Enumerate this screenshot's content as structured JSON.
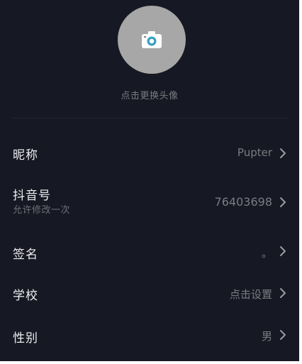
{
  "avatar": {
    "hint": "点击更换头像",
    "icon": "camera-icon",
    "bg_color": "#a7a7a7"
  },
  "rows": [
    {
      "label": "昵称",
      "sub": "",
      "value": "Pupter"
    },
    {
      "label": "抖音号",
      "sub": "允许修改一次",
      "value": "76403698"
    },
    {
      "label": "签名",
      "sub": "",
      "value": "。"
    },
    {
      "label": "学校",
      "sub": "",
      "value": "点击设置"
    },
    {
      "label": "性别",
      "sub": "",
      "value": "男"
    }
  ],
  "colors": {
    "background": "#161823",
    "label": "#eeeef0",
    "value": "#7b7c82",
    "chevron": "#9a9ba0"
  }
}
